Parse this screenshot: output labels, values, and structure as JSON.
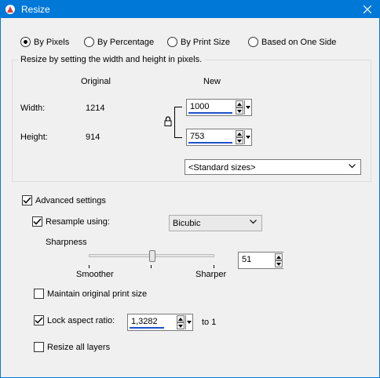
{
  "window": {
    "title": "Resize"
  },
  "modes": [
    {
      "label": "By Pixels",
      "selected": true
    },
    {
      "label": "By Percentage",
      "selected": false
    },
    {
      "label": "By Print Size",
      "selected": false
    },
    {
      "label": "Based on One Side",
      "selected": false
    }
  ],
  "group": {
    "legend": "Resize by setting the width and height in pixels.",
    "col_original": "Original",
    "col_new": "New",
    "width_label": "Width:",
    "height_label": "Height:",
    "original_width": "1214",
    "original_height": "914",
    "new_width": "1000",
    "new_height": "753",
    "standard_sizes": "<Standard sizes>"
  },
  "advanced": {
    "label": "Advanced settings",
    "checked": true,
    "resample_label": "Resample using:",
    "resample_checked": true,
    "resample_value": "Bicubic",
    "sharpness_label": "Sharpness",
    "smoother_label": "Smoother",
    "sharper_label": "Sharper",
    "sharpness_value": "51",
    "sharpness_fraction": 0.51,
    "maintain_print_label": "Maintain original print size",
    "maintain_print_checked": false,
    "lock_aspect_label": "Lock aspect ratio:",
    "lock_aspect_checked": true,
    "aspect_value": "1,3282",
    "to_label": "to 1",
    "resize_layers_label": "Resize all layers",
    "resize_layers_checked": false
  },
  "colors": {
    "titlebar": "#0078d7",
    "spin_underline": "#1e50c8"
  }
}
